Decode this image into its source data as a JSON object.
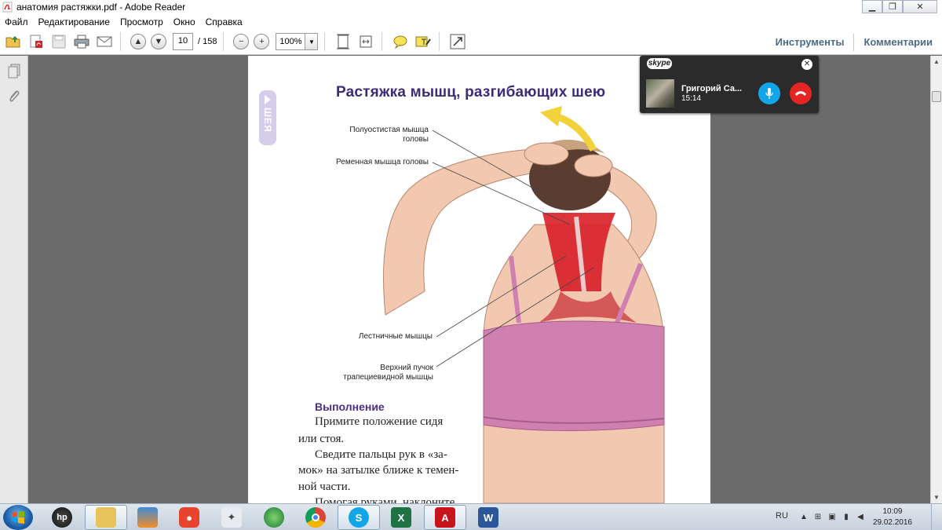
{
  "window": {
    "title": "анатомия растяжки.pdf - Adobe Reader",
    "minimize": "▁",
    "restore": "❐",
    "close": "✕"
  },
  "menu": [
    "Файл",
    "Редактирование",
    "Просмотр",
    "Окно",
    "Справка"
  ],
  "toolbar": {
    "page_current": "10",
    "page_total": "/ 158",
    "zoom": "100%",
    "tools_label": "Инструменты",
    "comments_label": "Комментарии"
  },
  "document": {
    "side_tab": "ШЕЯ",
    "title": "Растяжка мышц, разгибающих шею",
    "callouts": {
      "semispinalis_1": "Полуостистая мышца",
      "semispinalis_2": "головы",
      "splenius": "Ременная мышца головы",
      "scalene": "Лестничные мышцы",
      "trapezius_1": "Верхний пучок",
      "trapezius_2": "трапециевидной мышцы"
    },
    "section_heading": "Выполнение",
    "body_lines": [
      "Примите положение сидя",
      "или стоя.",
      "Сведите пальцы рук в «за-",
      "мок» на затылке ближе к темен-",
      "ной части.",
      "Помогая руками, наклоните"
    ]
  },
  "skype": {
    "logo": "skype",
    "caller_name": "Григорий Са...",
    "call_time": "15:14"
  },
  "taskbar": {
    "tray_lang": "RU",
    "clock_time": "10:09",
    "clock_date": "29.02.2016"
  },
  "colors": {
    "accent_purple": "#3d2a78",
    "skype_blue": "#12a5e8",
    "hangup_red": "#e52523",
    "muscle_red": "#d8232a",
    "bra_pink": "#cf7fb0"
  }
}
